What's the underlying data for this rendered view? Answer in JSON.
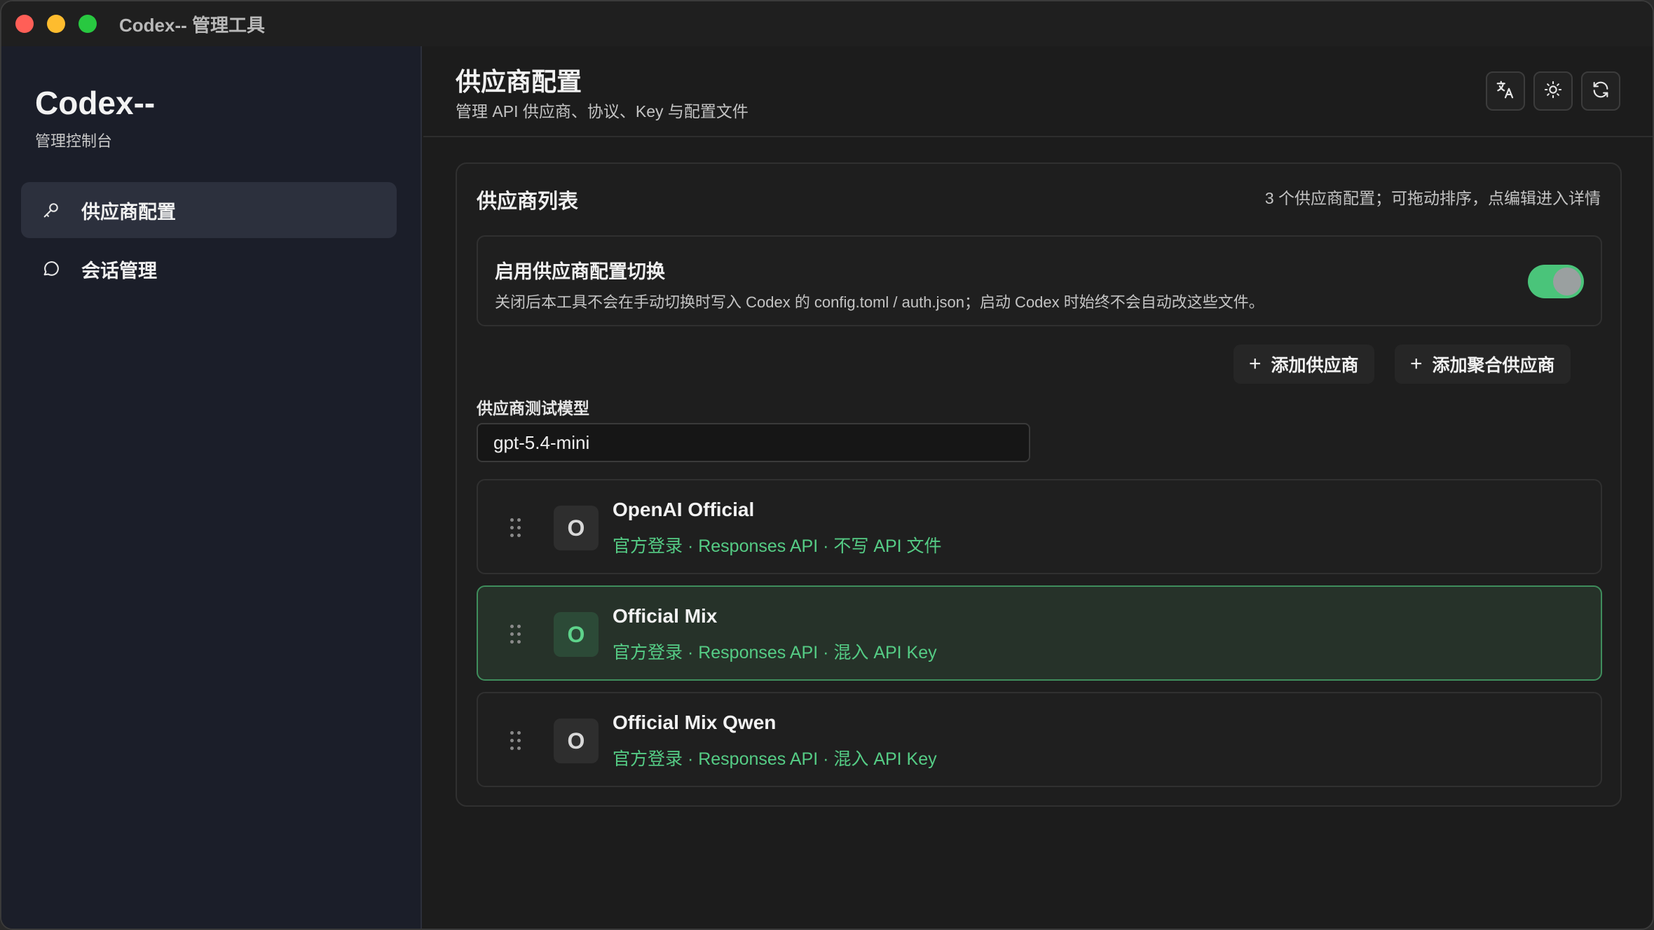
{
  "window": {
    "title": "Codex-- 管理工具"
  },
  "sidebar": {
    "brand": "Codex--",
    "subtitle": "管理控制台",
    "items": [
      {
        "label": "供应商配置",
        "icon": "key-icon",
        "active": true
      },
      {
        "label": "会话管理",
        "icon": "chat-bubble-icon",
        "active": false
      }
    ]
  },
  "header": {
    "title": "供应商配置",
    "subtitle": "管理 API 供应商、协议、Key 与配置文件",
    "buttons": [
      "translate-icon",
      "sun-icon",
      "refresh-icon"
    ]
  },
  "panel": {
    "title": "供应商列表",
    "meta": "3 个供应商配置；可拖动排序，点编辑进入详情",
    "toggle": {
      "title": "启用供应商配置切换",
      "description": "关闭后本工具不会在手动切换时写入 Codex 的 config.toml / auth.json；启动 Codex 时始终不会自动改这些文件。",
      "enabled": true
    },
    "add_provider_label": "添加供应商",
    "add_aggregate_label": "添加聚合供应商",
    "test_model_label": "供应商测试模型",
    "test_model_value": "gpt-5.4-mini",
    "providers": [
      {
        "initial": "O",
        "name": "OpenAI Official",
        "meta": "官方登录 · Responses API · 不写 API 文件",
        "selected": false
      },
      {
        "initial": "O",
        "name": "Official Mix",
        "meta": "官方登录 · Responses API · 混入 API Key",
        "selected": true
      },
      {
        "initial": "O",
        "name": "Official Mix Qwen",
        "meta": "官方登录 · Responses API · 混入 API Key",
        "selected": false
      }
    ]
  },
  "colors": {
    "accent_green": "#55cc85",
    "toggle_on": "#4ac47a",
    "sidebar_bg": "#1b1e29",
    "selected_card_bg": "#263229"
  }
}
